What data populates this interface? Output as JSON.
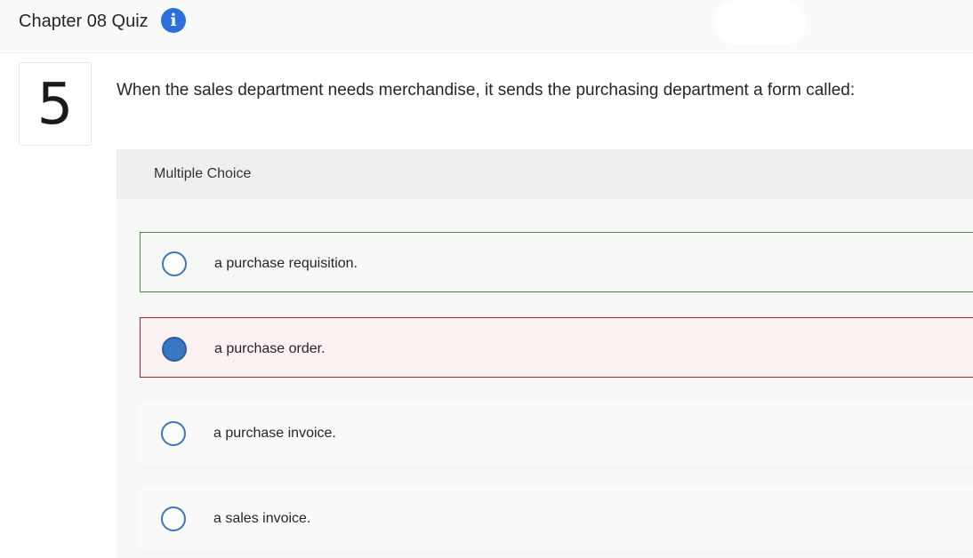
{
  "header": {
    "title": "Chapter 08 Quiz",
    "info_icon": "info-icon"
  },
  "question": {
    "number": "5",
    "text": "When the sales department needs merchandise, it sends the purchasing department a form called:",
    "type_label": "Multiple Choice"
  },
  "options": [
    {
      "label": "a purchase requisition.",
      "selected": false,
      "state": "correct"
    },
    {
      "label": "a purchase order.",
      "selected": true,
      "state": "incorrect"
    },
    {
      "label": "a purchase invoice.",
      "selected": false,
      "state": "none"
    },
    {
      "label": "a sales invoice.",
      "selected": false,
      "state": "none"
    }
  ],
  "colors": {
    "accent": "#3a77c3",
    "correct_border": "#3f8f3f",
    "incorrect_border": "#b22222"
  }
}
